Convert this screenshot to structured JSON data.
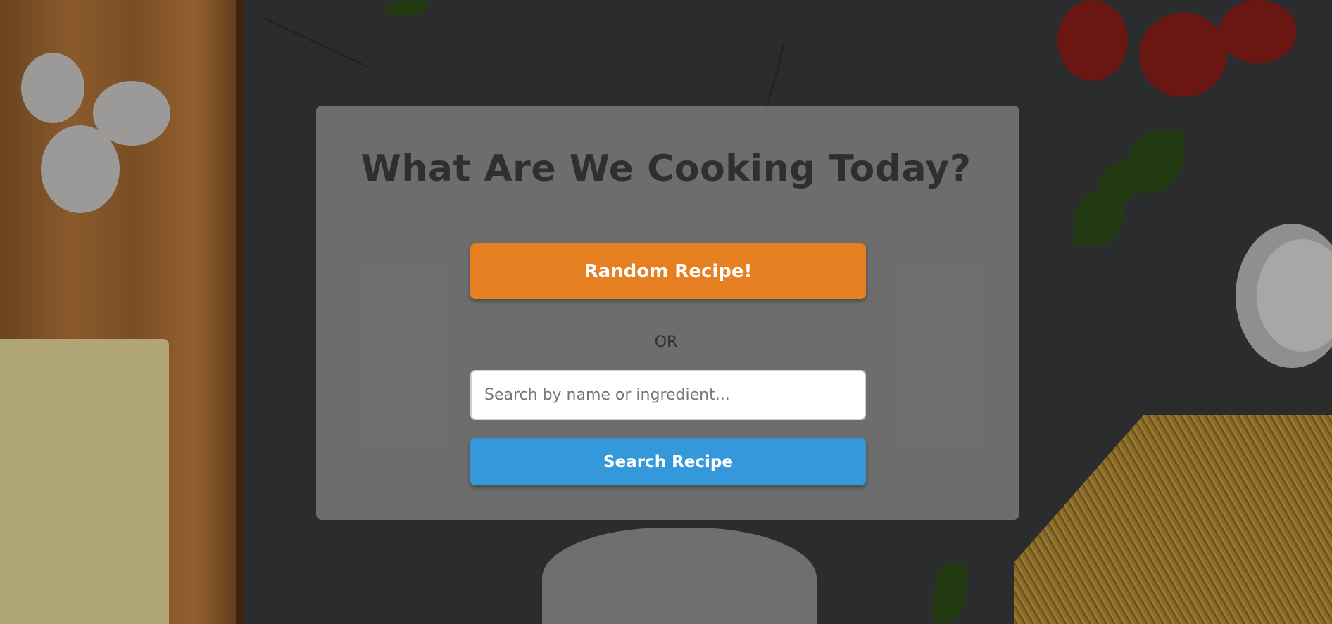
{
  "page": {
    "title": "What Are We Cooking Today?"
  },
  "actions": {
    "random_label": "Random Recipe!",
    "or_label": "OR",
    "search_placeholder": "Search by name or ingredient...",
    "search_value": "",
    "search_label": "Search Recipe"
  },
  "colors": {
    "random_button": "#e67e22",
    "search_button": "#3498db",
    "title_text": "#2f2f2f"
  }
}
